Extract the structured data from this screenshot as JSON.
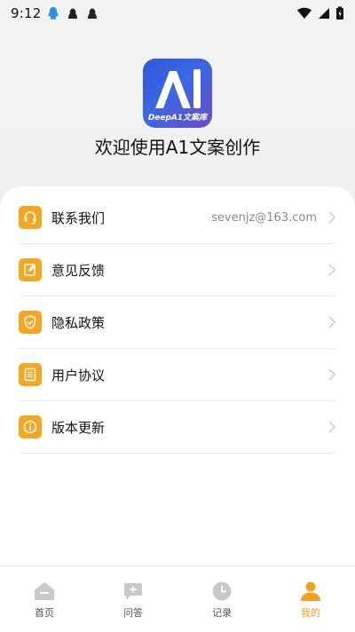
{
  "status_bar": {
    "time": "9:12"
  },
  "app": {
    "logo_text": "DeepA1文案库",
    "welcome": "欢迎使用A1文案创作"
  },
  "menu": {
    "items": [
      {
        "label": "联系我们",
        "value": "sevenjz@163.com",
        "icon": "headset-icon"
      },
      {
        "label": "意见反馈",
        "value": "",
        "icon": "edit-icon"
      },
      {
        "label": "隐私政策",
        "value": "",
        "icon": "shield-check-icon"
      },
      {
        "label": "用户协议",
        "value": "",
        "icon": "document-icon"
      },
      {
        "label": "版本更新",
        "value": "",
        "icon": "info-icon"
      }
    ]
  },
  "tabbar": {
    "tabs": [
      {
        "label": "首页",
        "icon": "home-icon",
        "active": false
      },
      {
        "label": "问答",
        "icon": "chat-plus-icon",
        "active": false
      },
      {
        "label": "记录",
        "icon": "clock-icon",
        "active": false
      },
      {
        "label": "我的",
        "icon": "user-icon",
        "active": true
      }
    ]
  },
  "colors": {
    "accent": "#f5a623",
    "active_tab": "#f0a11d",
    "inactive_icon": "#c9c9c9"
  }
}
